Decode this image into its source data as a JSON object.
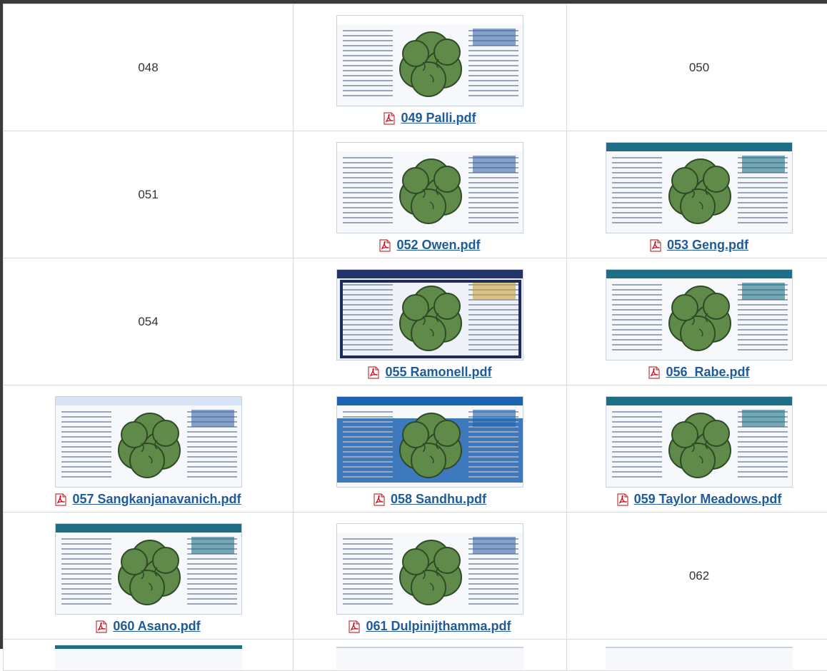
{
  "rows": [
    {
      "c1": {
        "number": "048"
      },
      "c2": {
        "file": "049 Palli.pdf"
      },
      "c3": {
        "number": "050"
      }
    },
    {
      "c1": {
        "number": "051"
      },
      "c2": {
        "file": "052 Owen.pdf"
      },
      "c3": {
        "file": "053 Geng.pdf"
      }
    },
    {
      "c1": {
        "number": "054"
      },
      "c2": {
        "file": "055 Ramonell.pdf"
      },
      "c3": {
        "file": "056_Rabe.pdf"
      }
    },
    {
      "c1": {
        "file": "057 Sangkanjanavanich.pdf"
      },
      "c2": {
        "file": "058 Sandhu.pdf"
      },
      "c3": {
        "file": "059 Taylor Meadows.pdf"
      }
    },
    {
      "c1": {
        "file": "060 Asano.pdf"
      },
      "c2": {
        "file": "061 Dulpinijthamma.pdf"
      },
      "c3": {
        "number": "062"
      }
    }
  ],
  "icons": {
    "pdf": "pdf-file-icon",
    "thumbnail_overlay": "tree-icon"
  },
  "colors": {
    "link": "#1f5a9a",
    "tree": "#5f8a4a",
    "pdf_red": "#d0021b"
  }
}
